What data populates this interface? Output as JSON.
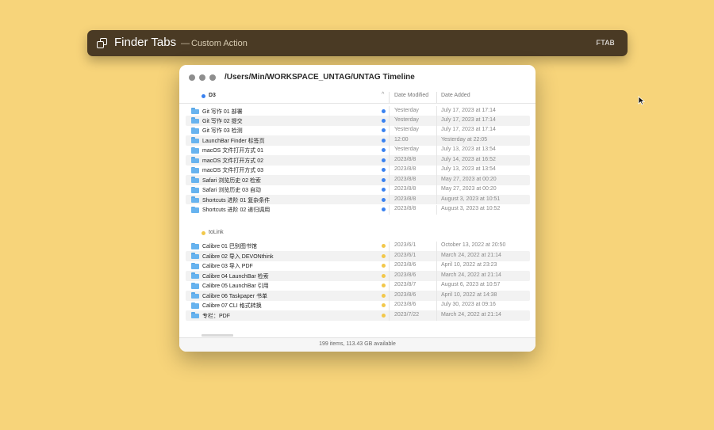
{
  "launcher": {
    "title": "Finder Tabs",
    "separator": "—",
    "subtitle": "Custom Action",
    "shortcut": "FTAB",
    "icon": "tabs-icon"
  },
  "window": {
    "path": "/Users/Min/WORKSPACE_UNTAG/UNTAG Timeline",
    "columns": {
      "modified": "Date Modified",
      "added": "Date Added"
    },
    "status": "199 items, 113.43 GB available"
  },
  "groups": [
    {
      "name": "D3",
      "color": "#3a82f0",
      "rows": [
        {
          "name": "Git 写作 01 部署",
          "modified": "Yesterday",
          "added": "July 17, 2023 at 17:14"
        },
        {
          "name": "Git 写作 02 提交",
          "modified": "Yesterday",
          "added": "July 17, 2023 at 17:14"
        },
        {
          "name": "Git 写作 03 检测",
          "modified": "Yesterday",
          "added": "July 17, 2023 at 17:14"
        },
        {
          "name": "LaunchBar Finder 标签页",
          "modified": "12:00",
          "added": "Yesterday at 22:05"
        },
        {
          "name": "macOS 文件打开方式 01",
          "modified": "Yesterday",
          "added": "July 13, 2023 at 13:54"
        },
        {
          "name": "macOS 文件打开方式 02",
          "modified": "2023/8/8",
          "added": "July 14, 2023 at 16:52"
        },
        {
          "name": "macOS 文件打开方式 03",
          "modified": "2023/8/8",
          "added": "July 13, 2023 at 13:54"
        },
        {
          "name": "Safari 浏览历史 02 检索",
          "modified": "2023/8/8",
          "added": "May 27, 2023 at 00:20"
        },
        {
          "name": "Safari 浏览历史 03 自动",
          "modified": "2023/8/8",
          "added": "May 27, 2023 at 00:20"
        },
        {
          "name": "Shortcuts 进阶 01 复杂条件",
          "modified": "2023/8/8",
          "added": "August 3, 2023 at 10:51"
        },
        {
          "name": "Shortcuts 进阶 02 递归调用",
          "modified": "2023/8/8",
          "added": "August 3, 2023 at 10:52"
        }
      ]
    },
    {
      "name": "toLink",
      "color": "#f2c84b",
      "rows": [
        {
          "name": "Calibre 01 巴别图书馆",
          "modified": "2023/6/1",
          "added": "October 13, 2022 at 20:50"
        },
        {
          "name": "Calibre 02 导入 DEVONthink",
          "modified": "2023/6/1",
          "added": "March 24, 2022 at 21:14"
        },
        {
          "name": "Calibre 03 导入 PDF",
          "modified": "2023/8/6",
          "added": "April 10, 2022 at 23:23"
        },
        {
          "name": "Calibre 04 LaunchBar 检索",
          "modified": "2023/8/6",
          "added": "March 24, 2022 at 21:14"
        },
        {
          "name": "Calibre 05 LaunchBar 引用",
          "modified": "2023/8/7",
          "added": "August 6, 2023 at 10:57"
        },
        {
          "name": "Calibre 06 Taskpaper 书单",
          "modified": "2023/8/6",
          "added": "April 10, 2022 at 14:38"
        },
        {
          "name": "Calibre 07 CLI 格式转换",
          "modified": "2023/8/6",
          "added": "July 30, 2023 at 09:16"
        },
        {
          "name": "专栏：PDF",
          "modified": "2023/7/22",
          "added": "March 24, 2022 at 21:14"
        }
      ]
    }
  ]
}
